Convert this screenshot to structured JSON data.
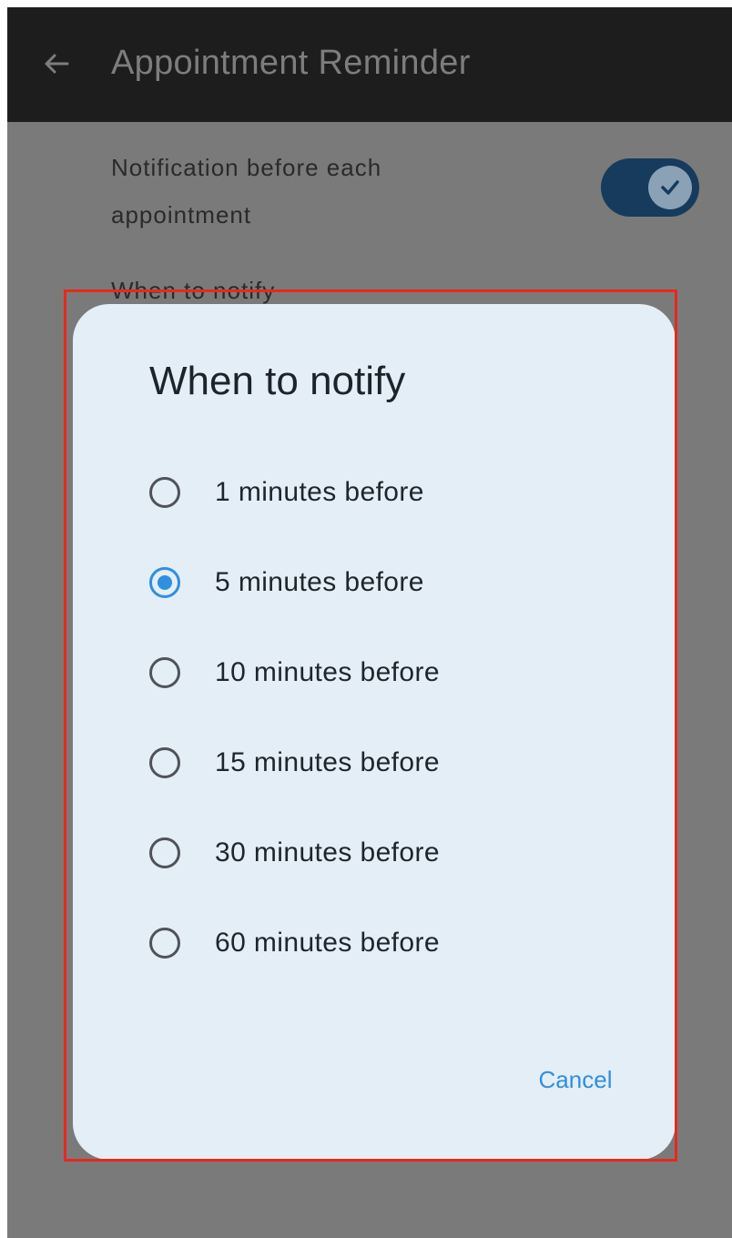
{
  "appbar": {
    "title": "Appointment Reminder"
  },
  "settings": {
    "notification_label_line1": "Notification before each",
    "notification_label_line2": "appointment",
    "notification_enabled": true,
    "when_to_notify_label": "When to notify"
  },
  "dialog": {
    "title": "When to notify",
    "options": [
      {
        "label": "1 minutes before",
        "selected": false
      },
      {
        "label": "5 minutes before",
        "selected": true
      },
      {
        "label": "10 minutes before",
        "selected": false
      },
      {
        "label": "15 minutes before",
        "selected": false
      },
      {
        "label": "30 minutes before",
        "selected": false
      },
      {
        "label": "60 minutes before",
        "selected": false
      }
    ],
    "cancel_label": "Cancel"
  },
  "colors": {
    "accent": "#2f8fe0",
    "dialog_bg": "#e4eef6",
    "highlight_border": "#e8281c",
    "appbar_bg": "#1d1d1d",
    "scrim": "#7a7a7a"
  },
  "icons": {
    "back": "arrow-left-icon",
    "toggle_check": "check-icon"
  }
}
